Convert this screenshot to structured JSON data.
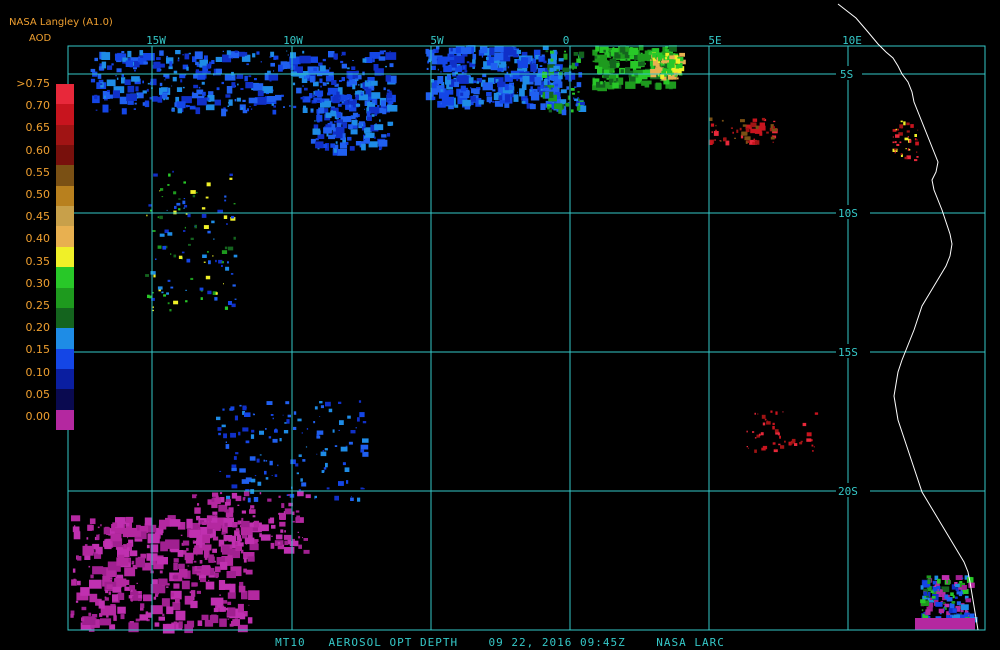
{
  "header": {
    "source": "NASA Langley (A1.0)",
    "product": "AOD"
  },
  "legend": {
    "labels": [
      ">0.75",
      "0.70",
      "0.65",
      "0.60",
      "0.55",
      "0.50",
      "0.45",
      "0.40",
      "0.35",
      "0.30",
      "0.25",
      "0.20",
      "0.15",
      "0.10",
      "0.05",
      "0.00"
    ],
    "colors": [
      "#e8283a",
      "#c8141e",
      "#a01414",
      "#78100c",
      "#7a5014",
      "#b8801e",
      "#c8a04a",
      "#e8b050",
      "#f0f028",
      "#28c828",
      "#1e9a1e",
      "#14641e",
      "#1e8ce6",
      "#1446e6",
      "#0a1ea0",
      "#0a0a50",
      "#b428a0"
    ]
  },
  "axes": {
    "lon_labels": [
      "15W",
      "10W",
      "5W",
      "0",
      "5E",
      "10E"
    ],
    "lat_labels": [
      "5S",
      "10S",
      "15S",
      "20S"
    ]
  },
  "footer": "MT10   AEROSOL OPT DEPTH    09 22, 2016 09:45Z    NASA LARC",
  "colors": {
    "grid": "#35c8c8",
    "coastline": "#ffffff",
    "header_text": "#f0a030",
    "background": "#000000"
  }
}
